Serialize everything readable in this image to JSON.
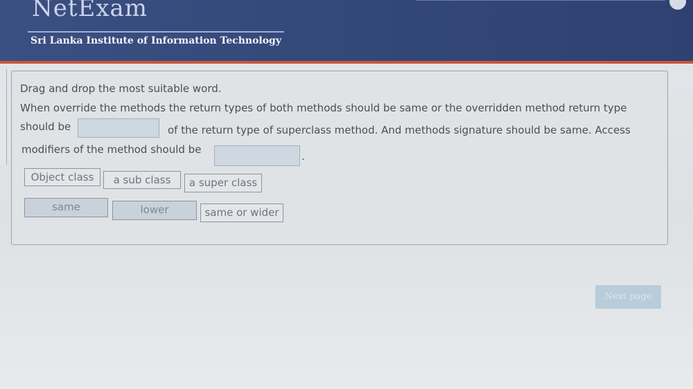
{
  "header": {
    "brand": "NetExam",
    "institute": "Sri Lanka Institute of Information Technology"
  },
  "question": {
    "instruction": "Drag and drop the most suitable word.",
    "line1": "When override the methods the return types of both methods should be same or the overridden method return type",
    "line2_start": "should be",
    "line2_end": "of the return type of superclass method. And methods signature should be same. Access",
    "line3": "modifiers of the method should be",
    "line3_end": "."
  },
  "choices_row1": [
    "Object class",
    "a sub class",
    "a super class"
  ],
  "choices_row2": [
    "same",
    "lower",
    "same or wider"
  ],
  "navigation": {
    "next_label": "Next page"
  },
  "colors": {
    "header_bg": "#34487a",
    "accent_line": "#c8583c",
    "drop_zone": "#cfd8e0",
    "next_button": "#b8ccd9"
  }
}
